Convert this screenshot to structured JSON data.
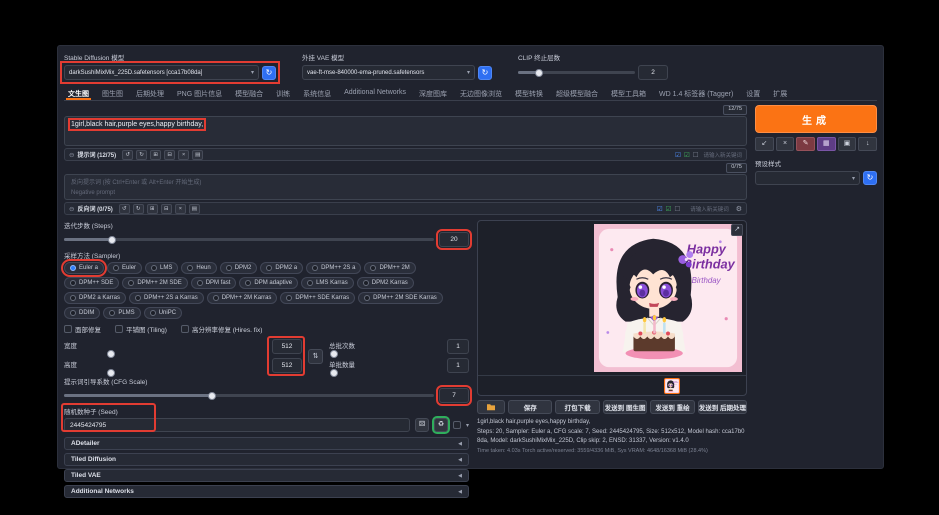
{
  "header": {
    "sd_model": {
      "label": "Stable Diffusion 模型",
      "value": "darkSushiMixMix_225D.safetensors [cca17b08da]"
    },
    "vae": {
      "label": "外挂 VAE 模型",
      "value": "vae-ft-mse-840000-ema-pruned.safetensors"
    },
    "clip_skip": {
      "label": "CLIP 终止层数",
      "value": "2"
    }
  },
  "tabs": [
    {
      "label": "文生图",
      "active": true
    },
    {
      "label": "图生图"
    },
    {
      "label": "后期处理"
    },
    {
      "label": "PNG 图片信息"
    },
    {
      "label": "模型融合"
    },
    {
      "label": "训练"
    },
    {
      "label": "系统信息"
    },
    {
      "label": "Additional Networks"
    },
    {
      "label": "深度图库"
    },
    {
      "label": "无边图像浏览"
    },
    {
      "label": "模型转换"
    },
    {
      "label": "超级模型融合"
    },
    {
      "label": "模型工具箱"
    },
    {
      "label": "WD 1.4 标签器 (Tagger)"
    },
    {
      "label": "设置"
    },
    {
      "label": "扩展"
    }
  ],
  "prompt": {
    "token_counter": "12/75",
    "text": "1girl,black hair,purple eyes,happy birthday,",
    "toolbar_label": "提示词 (12/75)",
    "keyword_placeholder": "请输入新关键词"
  },
  "negative": {
    "token_counter": "0/75",
    "toolbar_label": "反向词 (0/75)",
    "placeholder_line1": "反向提示词 (按 Ctrl+Enter 或 Alt+Enter 开始生成)",
    "placeholder_line2": "Negative prompt"
  },
  "settings": {
    "steps": {
      "label": "迭代步数 (Steps)",
      "value": "20"
    },
    "sampler": {
      "label": "采样方法 (Sampler)",
      "options": [
        {
          "label": "Euler a",
          "selected": true
        },
        {
          "label": "Euler"
        },
        {
          "label": "LMS"
        },
        {
          "label": "Heun"
        },
        {
          "label": "DPM2"
        },
        {
          "label": "DPM2 a"
        },
        {
          "label": "DPM++ 2S a"
        },
        {
          "label": "DPM++ 2M"
        },
        {
          "label": "DPM++ SDE"
        },
        {
          "label": "DPM++ 2M SDE"
        },
        {
          "label": "DPM fast"
        },
        {
          "label": "DPM adaptive"
        },
        {
          "label": "LMS Karras"
        },
        {
          "label": "DPM2 Karras"
        },
        {
          "label": "DPM2 a Karras"
        },
        {
          "label": "DPM++ 2S a Karras"
        },
        {
          "label": "DPM++ 2M Karras"
        },
        {
          "label": "DPM++ SDE Karras"
        },
        {
          "label": "DPM++ 2M SDE Karras"
        },
        {
          "label": "DDIM"
        },
        {
          "label": "PLMS"
        },
        {
          "label": "UniPC"
        }
      ]
    },
    "toggles": [
      "面部修复",
      "平铺图 (Tiling)",
      "高分辨率修复 (Hires. fix)"
    ],
    "width": {
      "label": "宽度",
      "value": "512"
    },
    "height": {
      "label": "高度",
      "value": "512"
    },
    "batch_count": {
      "label": "总批次数",
      "value": "1"
    },
    "batch_size": {
      "label": "单批数量",
      "value": "1"
    },
    "cfg": {
      "label": "提示词引导系数 (CFG Scale)",
      "value": "7"
    },
    "seed": {
      "label": "随机数种子 (Seed)",
      "value": "2445424795"
    }
  },
  "accordions": [
    "ADetailer",
    "Tiled Diffusion",
    "Tiled VAE",
    "Additional Networks"
  ],
  "generate": {
    "label": "生成"
  },
  "styles": {
    "label": "预设样式"
  },
  "actions": [
    "保存",
    "打包下载",
    "发送到 图生图",
    "发送到 重绘",
    "发送到 后期处理"
  ],
  "output_info": {
    "prompt": "1girl,black hair,purple eyes,happy birthday,",
    "params": "Steps: 20, Sampler: Euler a, CFG scale: 7, Seed: 2445424795, Size: 512x512, Model hash: cca17b08da, Model: darkSushiMixMix_225D, Clip skip: 2, ENSD: 31337, Version: v1.4.0",
    "perf": "Time taken: 4.03s Torch active/reserved: 3559/4336 MiB, Sys VRAM: 4648/16368 MiB (28.4%)"
  },
  "image_overlay": {
    "line1": "Happy",
    "line2": "Birthday",
    "line3": "Birthday"
  },
  "icons": {
    "dropdown": "▾",
    "refresh": "↻",
    "collapse": "⊖",
    "undo": "↺",
    "redo": "↻",
    "add": "⊞",
    "remove": "⊟",
    "clear": "×",
    "list": "▤",
    "check_blue": "☑",
    "check_green": "☑",
    "checkbox_empty": "☐",
    "gear": "⚙",
    "swap": "⇅",
    "dice": "⚄",
    "recycle": "♻",
    "paste": "↙",
    "clear_prompt": "×",
    "apply_style": "✎",
    "extra_networks": "▦",
    "save_style": "▣",
    "download": "↓",
    "fullscreen": "↗",
    "accordion_arrow": "◀"
  },
  "colors": {
    "accent_orange": "#fb7314",
    "accent_blue": "#2e6ff2",
    "annotation_red": "#e23c32",
    "annotation_green": "#2fae5c"
  }
}
